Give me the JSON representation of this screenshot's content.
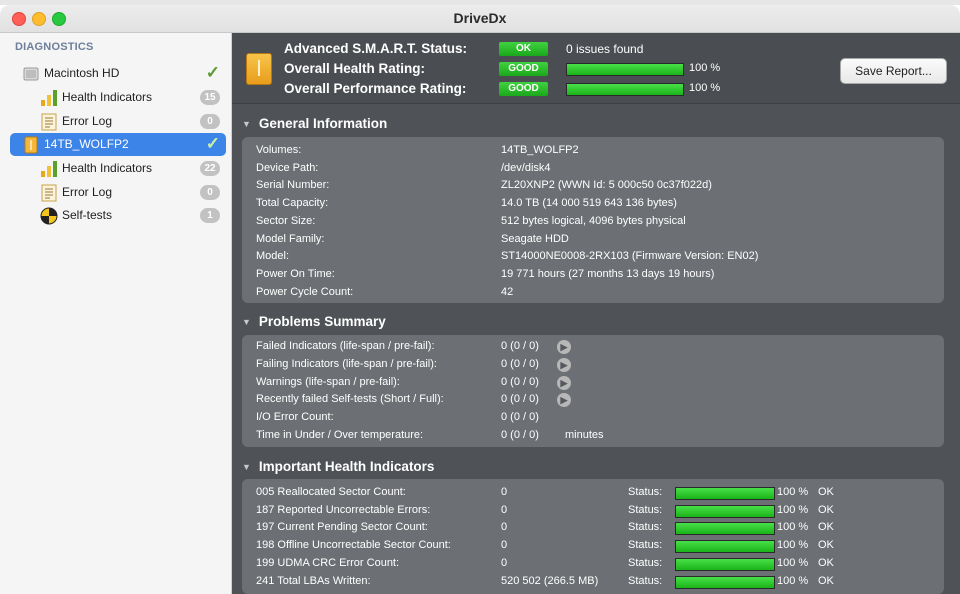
{
  "window": {
    "title": "DriveDx"
  },
  "sidebar": {
    "heading": "DIAGNOSTICS",
    "items": [
      {
        "label": "Macintosh HD",
        "icon": "internal-disk-icon",
        "check": "✓"
      },
      {
        "label": "Health Indicators",
        "icon": "bar-chart-icon",
        "badge": "15"
      },
      {
        "label": "Error Log",
        "icon": "document-icon",
        "badge": "0"
      },
      {
        "label": "14TB_WOLFP2",
        "icon": "external-disk-icon",
        "check": "✓",
        "selected": true
      },
      {
        "label": "Health Indicators",
        "icon": "bar-chart-icon",
        "badge": "22"
      },
      {
        "label": "Error Log",
        "icon": "document-icon",
        "badge": "0"
      },
      {
        "label": "Self-tests",
        "icon": "self-test-icon",
        "badge": "1"
      }
    ]
  },
  "status": {
    "smart_label": "Advanced S.M.A.R.T. Status:",
    "smart_badge": "OK",
    "smart_text": "0 issues found",
    "health_label": "Overall Health Rating:",
    "health_badge": "GOOD",
    "health_value": 100,
    "health_pct": "100 %",
    "perf_label": "Overall Performance Rating:",
    "perf_badge": "GOOD",
    "perf_value": 100,
    "perf_pct": "100 %",
    "save_button": "Save Report..."
  },
  "general": {
    "title": "General Information",
    "rows": [
      {
        "label": "Volumes:",
        "value": "14TB_WOLFP2"
      },
      {
        "label": "Device Path:",
        "value": "/dev/disk4"
      },
      {
        "label": "Serial Number:",
        "value": "ZL20XNP2 (WWN Id: 5 000c50 0c37f022d)"
      },
      {
        "label": "Total Capacity:",
        "value": "14.0 TB (14 000 519 643 136 bytes)"
      },
      {
        "label": "Sector Size:",
        "value": "512 bytes logical, 4096 bytes physical"
      },
      {
        "label": "Model Family:",
        "value": "Seagate HDD"
      },
      {
        "label": "Model:",
        "value": "ST14000NE0008-2RX103  (Firmware Version: EN02)"
      },
      {
        "label": "Power On Time:",
        "value": "19 771 hours (27 months 13 days 19 hours)"
      },
      {
        "label": "Power Cycle Count:",
        "value": "42"
      }
    ]
  },
  "problems": {
    "title": "Problems Summary",
    "rows": [
      {
        "label": "Failed Indicators (life-span / pre-fail):",
        "value": "0 (0 / 0)",
        "arrow": "▶"
      },
      {
        "label": "Failing Indicators (life-span / pre-fail):",
        "value": "0 (0 / 0)",
        "arrow": "▶"
      },
      {
        "label": "Warnings (life-span / pre-fail):",
        "value": "0 (0 / 0)",
        "arrow": "▶"
      },
      {
        "label": "Recently failed Self-tests (Short / Full):",
        "value": "0 (0 / 0)",
        "arrow": "▶"
      },
      {
        "label": "I/O Error Count:",
        "value": "0 (0 / 0)"
      },
      {
        "label": "Time in Under / Over temperature:",
        "value": "0 (0 / 0)",
        "unit": "minutes"
      }
    ]
  },
  "indicators": {
    "title": "Important Health Indicators",
    "status_label": "Status:",
    "rows": [
      {
        "label": "005  Reallocated Sector Count:",
        "value": "0",
        "level": 100,
        "pct": "100 %",
        "state": "OK"
      },
      {
        "label": "187  Reported Uncorrectable Errors:",
        "value": "0",
        "level": 100,
        "pct": "100 %",
        "state": "OK"
      },
      {
        "label": "197  Current Pending Sector Count:",
        "value": "0",
        "level": 100,
        "pct": "100 %",
        "state": "OK"
      },
      {
        "label": "198  Offline Uncorrectable Sector Count:",
        "value": "0",
        "level": 100,
        "pct": "100 %",
        "state": "OK"
      },
      {
        "label": "199  UDMA CRC Error Count:",
        "value": "0",
        "level": 100,
        "pct": "100 %",
        "state": "OK"
      },
      {
        "label": "241  Total LBAs Written:",
        "value": "520 502 (266.5 MB)",
        "level": 100,
        "pct": "100 %",
        "state": "OK"
      }
    ]
  },
  "colors": {
    "accent": "#3d84e8",
    "good": "#1fb41f",
    "panel": "#6c7074",
    "background": "#4f5357"
  }
}
